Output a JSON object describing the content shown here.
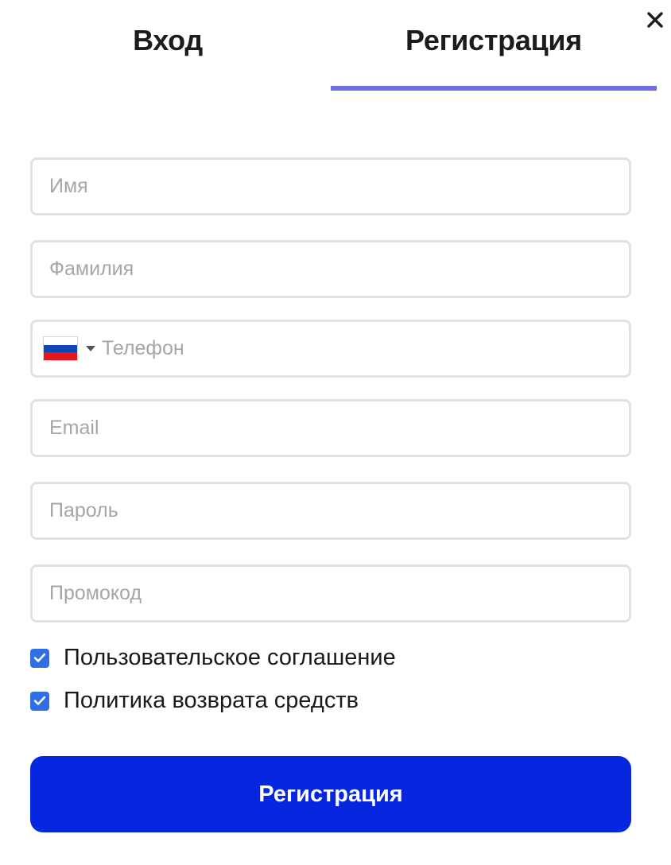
{
  "tabs": {
    "login_label": "Вход",
    "register_label": "Регистрация",
    "active": "register"
  },
  "close": {
    "icon": "close-icon"
  },
  "form": {
    "first_name": {
      "placeholder": "Имя",
      "value": ""
    },
    "last_name": {
      "placeholder": "Фамилия",
      "value": ""
    },
    "phone": {
      "placeholder": "Телефон",
      "value": "",
      "country_flag_icon": "russia-flag-icon",
      "flag_colors": [
        "#ffffff",
        "#0c47b7",
        "#e4181c"
      ]
    },
    "email": {
      "placeholder": "Email",
      "value": ""
    },
    "password": {
      "placeholder": "Пароль",
      "value": ""
    },
    "promo": {
      "placeholder": "Промокод",
      "value": ""
    }
  },
  "agreements": {
    "user_agreement": {
      "label": "Пользовательское соглашение",
      "checked": true
    },
    "refund_policy": {
      "label": "Политика возврата средств",
      "checked": true
    }
  },
  "submit": {
    "label": "Регистрация"
  },
  "colors": {
    "accent_underline": "#6f6ee8",
    "primary_button": "#0726e0",
    "checkbox": "#2f6fe3",
    "field_border": "#e2e2e2",
    "placeholder_text": "#a6a6a6"
  }
}
